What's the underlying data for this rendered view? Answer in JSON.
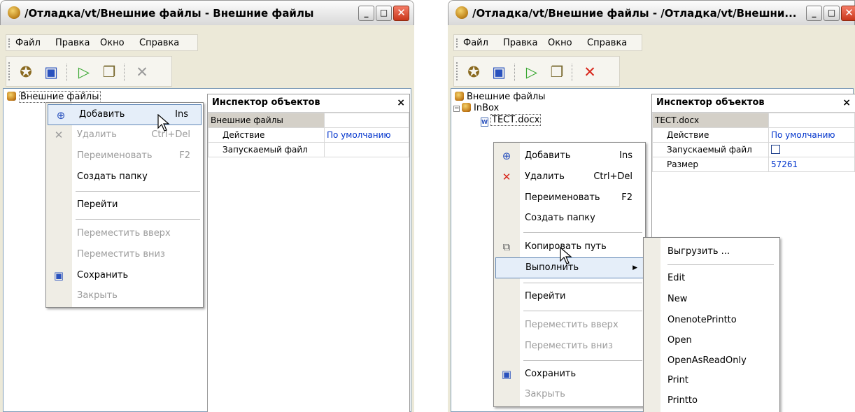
{
  "window1": {
    "title": "/Отладка/vt/Внешние файлы - Внешние файлы",
    "menu": [
      "Файл",
      "Правка",
      "Окно",
      "Справка"
    ],
    "tree_root": "Внешние файлы",
    "inspector": {
      "title": "Инспектор объектов",
      "close": "×",
      "header": "Внешние файлы",
      "props": [
        {
          "name": "Действие",
          "value": "По умолчанию"
        },
        {
          "name": "Запускаемый файл",
          "value": ""
        }
      ]
    },
    "context_menu": [
      {
        "label": "Добавить",
        "shortcut": "Ins",
        "state": "highlighted",
        "icon": "add-icon"
      },
      {
        "label": "Удалить",
        "shortcut": "Ctrl+Del",
        "state": "disabled",
        "icon": "delete-icon"
      },
      {
        "label": "Переименовать",
        "shortcut": "F2",
        "state": "disabled"
      },
      {
        "label": "Создать папку",
        "shortcut": ""
      },
      {
        "label": "Перейти",
        "shortcut": ""
      },
      {
        "label": "Переместить вверх",
        "shortcut": "",
        "state": "disabled"
      },
      {
        "label": "Переместить вниз",
        "shortcut": "",
        "state": "disabled"
      },
      {
        "label": "Сохранить",
        "shortcut": "",
        "icon": "save-icon"
      },
      {
        "label": "Закрыть",
        "shortcut": "",
        "state": "disabled"
      }
    ]
  },
  "window2": {
    "title": "/Отладка/vt/Внешние файлы - /Отладка/vt/Внешни...",
    "menu": [
      "Файл",
      "Правка",
      "Окно",
      "Справка"
    ],
    "tree": [
      "Внешние файлы",
      "InBox",
      "ТЕСТ.docx"
    ],
    "inspector": {
      "title": "Инспектор объектов",
      "close": "×",
      "header": "ТЕСТ.docx",
      "props": [
        {
          "name": "Действие",
          "value": "По умолчанию"
        },
        {
          "name": "Запускаемый файл",
          "value": ""
        },
        {
          "name": "Размер",
          "value": "57261"
        }
      ]
    },
    "context_menu": [
      {
        "label": "Добавить",
        "shortcut": "Ins",
        "icon": "add-icon"
      },
      {
        "label": "Удалить",
        "shortcut": "Ctrl+Del",
        "icon": "delete-icon"
      },
      {
        "label": "Переименовать",
        "shortcut": "F2"
      },
      {
        "label": "Создать папку",
        "shortcut": ""
      },
      {
        "label": "Копировать путь",
        "shortcut": "",
        "icon": "copy-icon"
      },
      {
        "label": "Выполнить",
        "shortcut": "",
        "state": "highlighted",
        "submenu": true
      },
      {
        "label": "Перейти",
        "shortcut": ""
      },
      {
        "label": "Переместить вверх",
        "shortcut": "",
        "state": "disabled"
      },
      {
        "label": "Переместить вниз",
        "shortcut": "",
        "state": "disabled"
      },
      {
        "label": "Сохранить",
        "shortcut": "",
        "icon": "save-icon"
      },
      {
        "label": "Закрыть",
        "shortcut": "",
        "state": "disabled"
      }
    ],
    "submenu": [
      "Выгрузить ...",
      "Edit",
      "New",
      "OnenotePrintto",
      "Open",
      "OpenAsReadOnly",
      "Print",
      "Printto"
    ]
  },
  "colors": {
    "accent": "#6288B7",
    "highlight": "#E5EEF9",
    "link_value": "#0033cc"
  }
}
